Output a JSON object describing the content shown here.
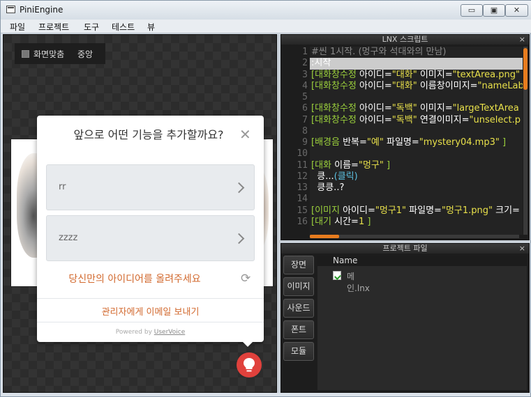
{
  "window": {
    "title": "PiniEngine",
    "min_label": "▭",
    "max_label": "▣",
    "close_label": "✕"
  },
  "menu": [
    "파일",
    "프로젝트",
    "도구",
    "테스트",
    "뷰"
  ],
  "stage": {
    "fit_label": "화면맞춤",
    "center_label": "중앙"
  },
  "feedback": {
    "title": "앞으로 어떤 기능을 추가할까요?",
    "close_label": "✕",
    "options": [
      "rr",
      "zzzz"
    ],
    "idea_link": "당신만의 아이디어를 올려주세요",
    "admin_link": "관리자에게 이메일 보내기",
    "powered_prefix": "Powered by ",
    "powered_brand": "UserVoice",
    "accent_color": "#d2692e",
    "bulb_color": "#e0413c"
  },
  "script_panel": {
    "title": "LNX 스크립트",
    "close_label": "×",
    "line_numbers": [
      "1",
      "2",
      "3",
      "4",
      "5",
      "6",
      "7",
      "8",
      "9",
      "10",
      "11",
      "12",
      "13",
      "14",
      "15",
      "16"
    ],
    "lines": [
      [
        {
          "c": "cm",
          "t": "#씬 1시작. (멍구와 석대와의 만남)"
        }
      ],
      [
        {
          "c": "pl",
          "t": ":시작"
        }
      ],
      [
        {
          "c": "tg",
          "t": "[대화창수정 "
        },
        {
          "c": "pl",
          "t": "아이디="
        },
        {
          "c": "st",
          "t": "\"대화\" "
        },
        {
          "c": "pl",
          "t": "이미지="
        },
        {
          "c": "st",
          "t": "\"textArea.png\""
        }
      ],
      [
        {
          "c": "tg",
          "t": "[대화창수정 "
        },
        {
          "c": "pl",
          "t": "아이디="
        },
        {
          "c": "st",
          "t": "\"대화\" "
        },
        {
          "c": "pl",
          "t": "이름창이미지="
        },
        {
          "c": "st",
          "t": "\"nameLab"
        }
      ],
      [],
      [
        {
          "c": "tg",
          "t": "[대화창수정 "
        },
        {
          "c": "pl",
          "t": "아이디="
        },
        {
          "c": "st",
          "t": "\"독백\" "
        },
        {
          "c": "pl",
          "t": "이미지="
        },
        {
          "c": "st",
          "t": "\"largeTextArea"
        }
      ],
      [
        {
          "c": "tg",
          "t": "[대화창수정 "
        },
        {
          "c": "pl",
          "t": "아이디="
        },
        {
          "c": "st",
          "t": "\"독백\" "
        },
        {
          "c": "pl",
          "t": "연결이미지="
        },
        {
          "c": "st",
          "t": "\"unselect.p"
        }
      ],
      [],
      [
        {
          "c": "tg",
          "t": "[배경음 "
        },
        {
          "c": "pl",
          "t": "반복="
        },
        {
          "c": "st",
          "t": "\"예\" "
        },
        {
          "c": "pl",
          "t": "파일명="
        },
        {
          "c": "st",
          "t": "\"mystery04.mp3\" "
        },
        {
          "c": "tg",
          "t": "]"
        }
      ],
      [],
      [
        {
          "c": "tg",
          "t": "[대화 "
        },
        {
          "c": "pl",
          "t": "이름="
        },
        {
          "c": "st",
          "t": "\"멍구\" "
        },
        {
          "c": "tg",
          "t": "]"
        }
      ],
      [
        {
          "c": "pl",
          "t": "  킁..."
        },
        {
          "c": "bl",
          "t": "(클릭)"
        }
      ],
      [
        {
          "c": "pl",
          "t": "  킁킁..?"
        }
      ],
      [],
      [
        {
          "c": "tg",
          "t": "[이미지 "
        },
        {
          "c": "pl",
          "t": "아이디="
        },
        {
          "c": "st",
          "t": "\"멍구1\" "
        },
        {
          "c": "pl",
          "t": "파일명="
        },
        {
          "c": "st",
          "t": "\"멍구1.png\" "
        },
        {
          "c": "pl",
          "t": "크기="
        }
      ],
      [
        {
          "c": "tg",
          "t": "[대기 "
        },
        {
          "c": "pl",
          "t": "시간="
        },
        {
          "c": "st",
          "t": "1 "
        },
        {
          "c": "tg",
          "t": "]"
        }
      ]
    ],
    "selected_line": 2
  },
  "project_panel": {
    "title": "프로젝트 파일",
    "close_label": "×",
    "tabs": [
      "장면",
      "이미지",
      "사운드",
      "폰트",
      "모듈"
    ],
    "column_header": "Name",
    "files": [
      "메인.lnx"
    ]
  }
}
